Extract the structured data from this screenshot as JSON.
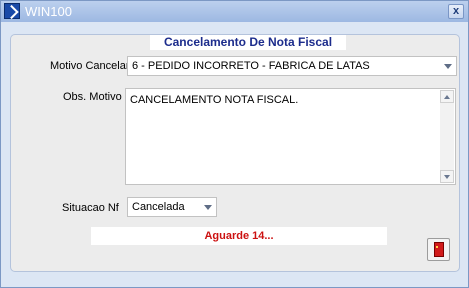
{
  "window": {
    "title": "WIN100",
    "close_glyph": "x"
  },
  "form": {
    "header": "Cancelamento De Nota Fiscal",
    "motivo_label": "Motivo Cancelamento",
    "motivo_value": "6 - PEDIDO INCORRETO - FABRICA DE LATAS",
    "obs_label": "Obs. Motivo",
    "obs_value": "CANCELAMENTO NOTA FISCAL.",
    "situacao_label": "Situacao Nf",
    "situacao_value": "Cancelada",
    "status_message": "Aguarde 14..."
  },
  "colors": {
    "status_text": "#cc1111",
    "header_text": "#1c2c8c",
    "exit_icon": "#d11a1a"
  },
  "icons": {
    "app": "app-icon",
    "close": "close-icon",
    "dropdown": "chevron-down-icon",
    "exit": "exit-door-icon"
  }
}
